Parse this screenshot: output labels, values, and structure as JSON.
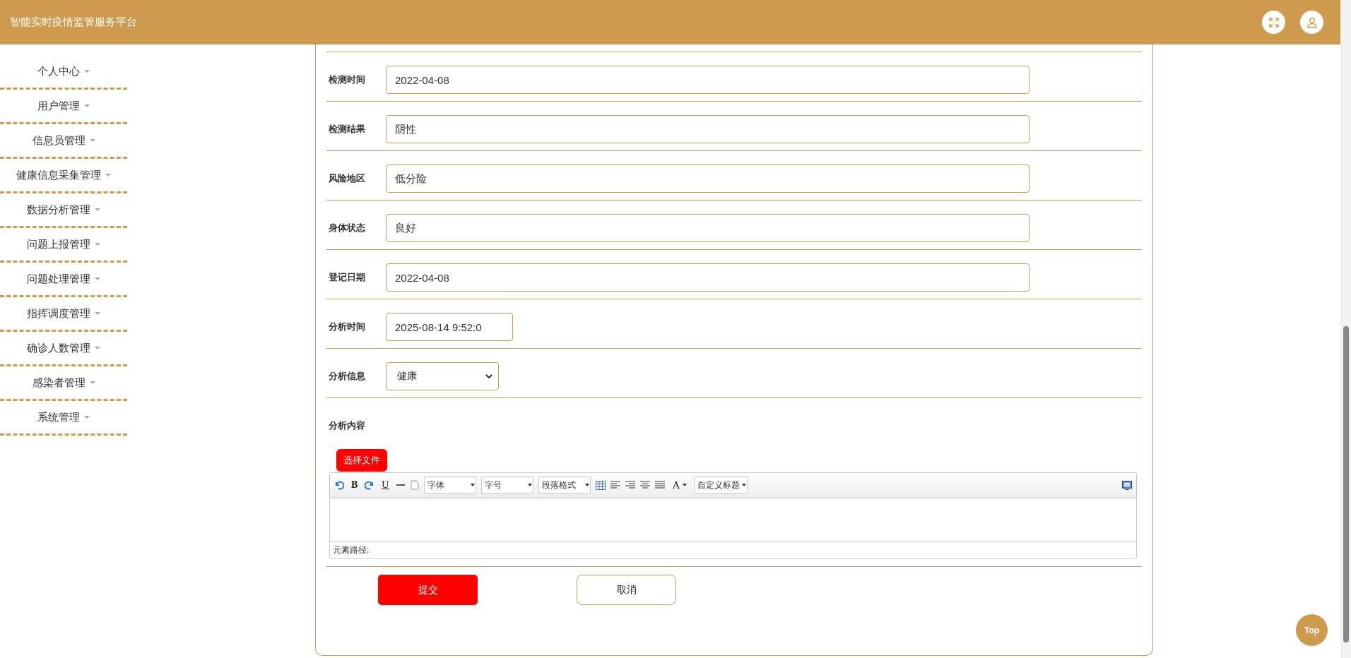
{
  "header": {
    "title": "智能实时疫情监管服务平台"
  },
  "sidebar": {
    "items": [
      {
        "label": "个人中心"
      },
      {
        "label": "用户管理"
      },
      {
        "label": "信息员管理"
      },
      {
        "label": "健康信息采集管理"
      },
      {
        "label": "数据分析管理"
      },
      {
        "label": "问题上报管理"
      },
      {
        "label": "问题处理管理"
      },
      {
        "label": "指挥调度管理"
      },
      {
        "label": "确诊人数管理"
      },
      {
        "label": "感染者管理"
      },
      {
        "label": "系统管理"
      }
    ]
  },
  "form": {
    "fields": [
      {
        "kind": "input",
        "label": "检测时间",
        "value": "2022-04-08"
      },
      {
        "kind": "input",
        "label": "检测结果",
        "value": "阴性"
      },
      {
        "kind": "input",
        "label": "风险地区",
        "value": "低分险"
      },
      {
        "kind": "input",
        "label": "身体状态",
        "value": "良好"
      },
      {
        "kind": "input",
        "label": "登记日期",
        "value": "2022-04-08"
      },
      {
        "kind": "short-input",
        "label": "分析时间",
        "value": "2025-08-14 9:52:0"
      },
      {
        "kind": "select",
        "label": "分析信息",
        "value": "健康"
      }
    ],
    "content": {
      "label": "分析内容",
      "upload_button": "选择文件",
      "toolbar": [
        {
          "kind": "undo"
        },
        {
          "kind": "bold",
          "text": "B"
        },
        {
          "kind": "redo"
        },
        {
          "kind": "underline",
          "text": "U"
        },
        {
          "kind": "rule"
        },
        {
          "kind": "page"
        },
        {
          "kind": "dropdown",
          "text": "字体"
        },
        {
          "kind": "dropdown",
          "text": "字号"
        },
        {
          "kind": "dropdown",
          "text": "段落格式"
        },
        {
          "kind": "table"
        },
        {
          "kind": "align-left"
        },
        {
          "kind": "align-right"
        },
        {
          "kind": "align-center"
        },
        {
          "kind": "justify"
        },
        {
          "kind": "color",
          "text": "A"
        },
        {
          "kind": "dropdown",
          "text": "自定义标题"
        },
        {
          "kind": "fullscreen"
        }
      ],
      "path_label": "元素路径:"
    },
    "submit": "提交",
    "cancel": "取消"
  },
  "back_to_top": "Top"
}
